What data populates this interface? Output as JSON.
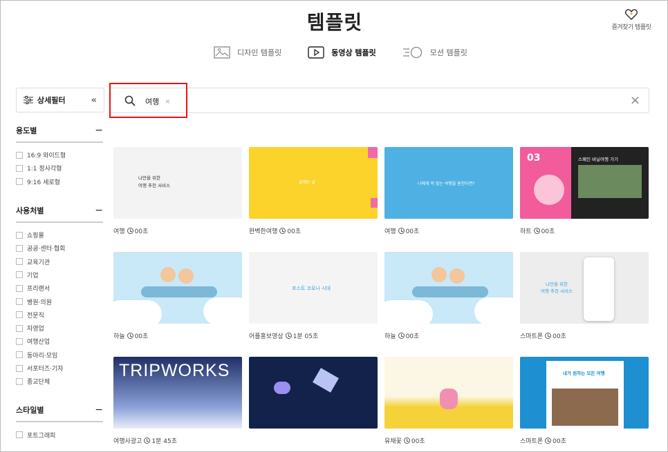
{
  "header": {
    "title": "템플릿",
    "favorite_label": "즐겨찾기 템플릿"
  },
  "tabs": [
    {
      "label": "디자인 템플릿",
      "active": false,
      "icon": "image-icon"
    },
    {
      "label": "동영상 템플릿",
      "active": true,
      "icon": "play-icon"
    },
    {
      "label": "모션 템플릿",
      "active": false,
      "icon": "motion-icon"
    }
  ],
  "filter": {
    "label": "상세필터",
    "collapse_icon": "«"
  },
  "search": {
    "chip": "여행",
    "chip_remove": "×",
    "clear": "×"
  },
  "sidebar": {
    "sections": [
      {
        "title": "용도별",
        "toggle": "−",
        "options": [
          "16:9 와이드형",
          "1:1 정사각형",
          "9:16 세로형"
        ]
      },
      {
        "title": "사용처별",
        "toggle": "−",
        "options": [
          "쇼핑몰",
          "공공·센터·협회",
          "교육기관",
          "기업",
          "프리랜서",
          "병원·의원",
          "전문직",
          "자영업",
          "여행산업",
          "동아리·모임",
          "서포터즈·기자",
          "종교단체"
        ]
      },
      {
        "title": "스타일별",
        "toggle": "−",
        "options": [
          "포트그래피"
        ]
      }
    ]
  },
  "cards": [
    {
      "name": "여행",
      "duration": "00초",
      "thumb_text": "나만을 위한\n여행 추천 서비스",
      "bg": "#f3f3f3"
    },
    {
      "name": "완벽한여행",
      "duration": "00초",
      "thumb_text": "설레는 날",
      "bg": "#fbd32b"
    },
    {
      "name": "여행",
      "duration": "00초",
      "thumb_text": "나에게 딱 맞는 여행을 원한다면?",
      "bg": "#4fb1e3"
    },
    {
      "name": "하트",
      "duration": "00초",
      "thumb_text": "스페인 바닐여행 가기",
      "bg": "#f25c9a"
    },
    {
      "name": "하늘",
      "duration": "00초",
      "thumb_text": "",
      "bg": "#c9e8f8"
    },
    {
      "name": "어플홍보영상",
      "duration": "1분 05초",
      "thumb_text": "포스트 코로나 시대",
      "bg": "#f4f4f4"
    },
    {
      "name": "하늘",
      "duration": "00초",
      "thumb_text": "",
      "bg": "#c9e8f8"
    },
    {
      "name": "스마트폰",
      "duration": "00초",
      "thumb_text": "나만을 위한\n여행 추천 서비스",
      "bg": "#ededed"
    },
    {
      "name": "여행사광고",
      "duration": "1분 45초",
      "thumb_text": "TRIPWORKS",
      "bg": "#283d74"
    },
    {
      "name": "",
      "duration": "",
      "thumb_text": "",
      "bg": "#12224a"
    },
    {
      "name": "유채꽃",
      "duration": "00초",
      "thumb_text": "",
      "bg": "#fbf7e4"
    },
    {
      "name": "스마트폰",
      "duration": "00초",
      "thumb_text": "내가 원하는 모든 여행",
      "bg": "#1e8fd0"
    }
  ]
}
